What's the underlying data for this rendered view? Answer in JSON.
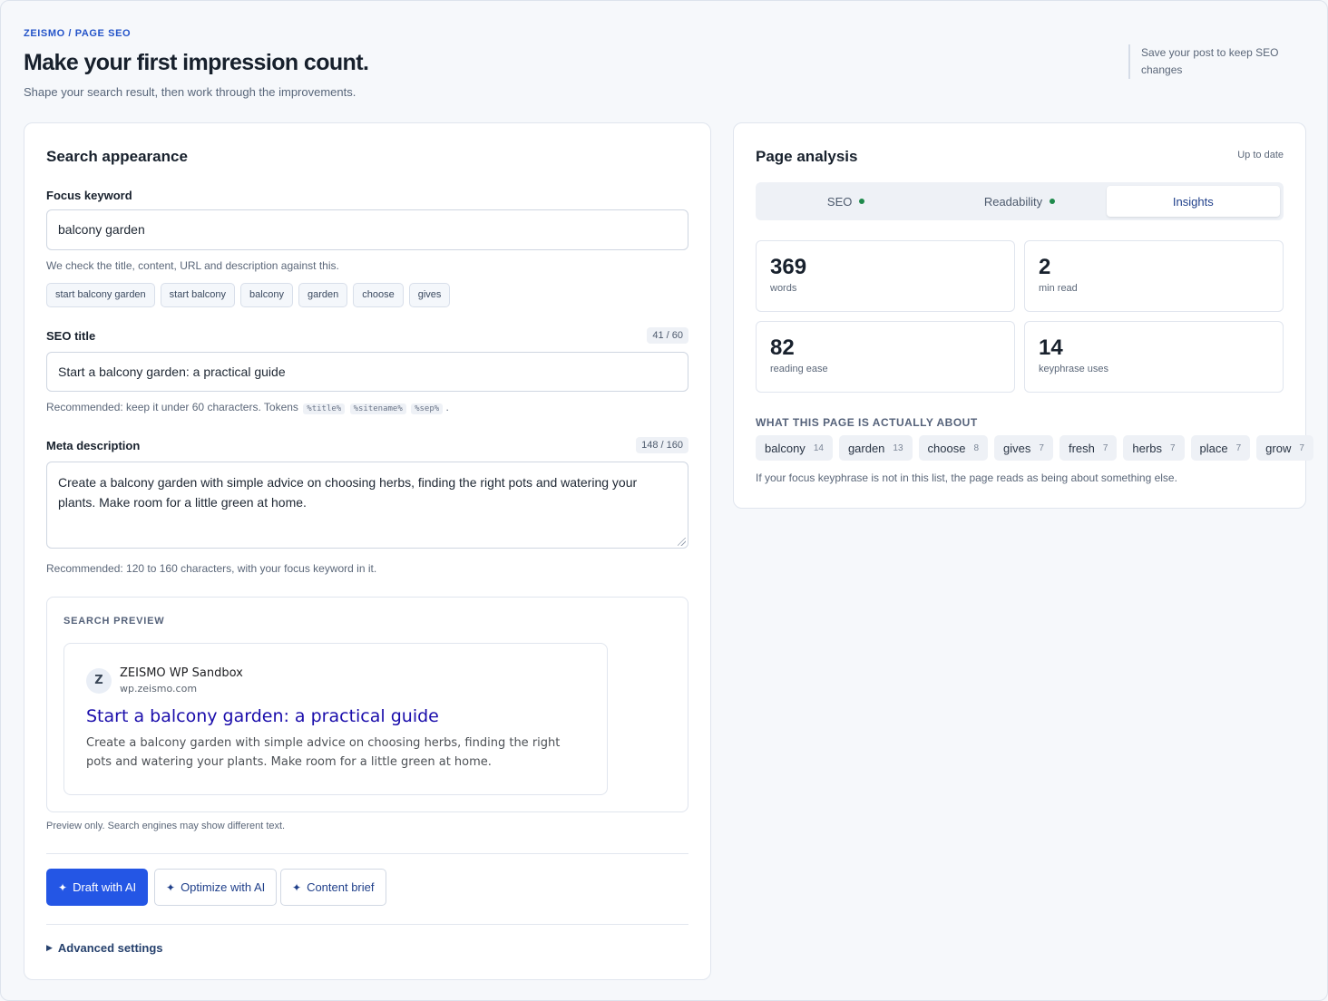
{
  "header": {
    "breadcrumb": "ZEISMO / PAGE SEO",
    "title": "Make your first impression count.",
    "subtitle": "Shape your search result, then work through the improvements.",
    "save_note": "Save your post to keep SEO changes"
  },
  "search_appearance": {
    "title": "Search appearance",
    "focus_keyword": {
      "label": "Focus keyword",
      "value": "balcony garden",
      "help": "We check the title, content, URL and description against this.",
      "suggestions": [
        "start balcony garden",
        "start balcony",
        "balcony",
        "garden",
        "choose",
        "gives"
      ]
    },
    "seo_title": {
      "label": "SEO title",
      "counter": "41 / 60",
      "value": "Start a balcony garden: a practical guide",
      "help_prefix": "Recommended: keep it under 60 characters. Tokens",
      "tokens": [
        "%title%",
        "%sitename%",
        "%sep%"
      ],
      "help_suffix": "."
    },
    "meta_description": {
      "label": "Meta description",
      "counter": "148 / 160",
      "value": "Create a balcony garden with simple advice on choosing herbs, finding the right pots and watering your plants. Make room for a little green at home.",
      "help": "Recommended: 120 to 160 characters, with your focus keyword in it."
    },
    "preview": {
      "heading": "SEARCH PREVIEW",
      "favicon_letter": "Z",
      "site_name": "ZEISMO WP Sandbox",
      "site_url": "wp.zeismo.com",
      "title": "Start a balcony garden: a practical guide",
      "description": "Create a balcony garden with simple advice on choosing herbs, finding the right pots and watering your plants. Make room for a little green at home.",
      "note": "Preview only. Search engines may show different text."
    },
    "actions": {
      "draft": "Draft with AI",
      "optimize": "Optimize with AI",
      "brief": "Content brief",
      "icon": "sparkle-icon"
    },
    "advanced": "Advanced settings"
  },
  "page_analysis": {
    "title": "Page analysis",
    "status": "Up to date",
    "tabs": [
      {
        "label": "SEO",
        "dot": true
      },
      {
        "label": "Readability",
        "dot": true
      },
      {
        "label": "Insights",
        "dot": false,
        "active": true
      }
    ],
    "stats": [
      {
        "value": "369",
        "label": "words"
      },
      {
        "value": "2",
        "label": "min read"
      },
      {
        "value": "82",
        "label": "reading ease"
      },
      {
        "value": "14",
        "label": "keyphrase uses"
      }
    ],
    "topics_heading": "WHAT THIS PAGE IS ACTUALLY ABOUT",
    "topics": [
      {
        "word": "balcony",
        "count": "14"
      },
      {
        "word": "garden",
        "count": "13"
      },
      {
        "word": "choose",
        "count": "8"
      },
      {
        "word": "gives",
        "count": "7"
      },
      {
        "word": "fresh",
        "count": "7"
      },
      {
        "word": "herbs",
        "count": "7"
      },
      {
        "word": "place",
        "count": "7"
      },
      {
        "word": "grow",
        "count": "7"
      }
    ],
    "topics_note": "If your focus keyphrase is not in this list, the page reads as being about something else."
  },
  "colors": {
    "accent": "#2456e5",
    "serp_title": "#1a0dab",
    "ok_dot": "#1f8a4c"
  }
}
